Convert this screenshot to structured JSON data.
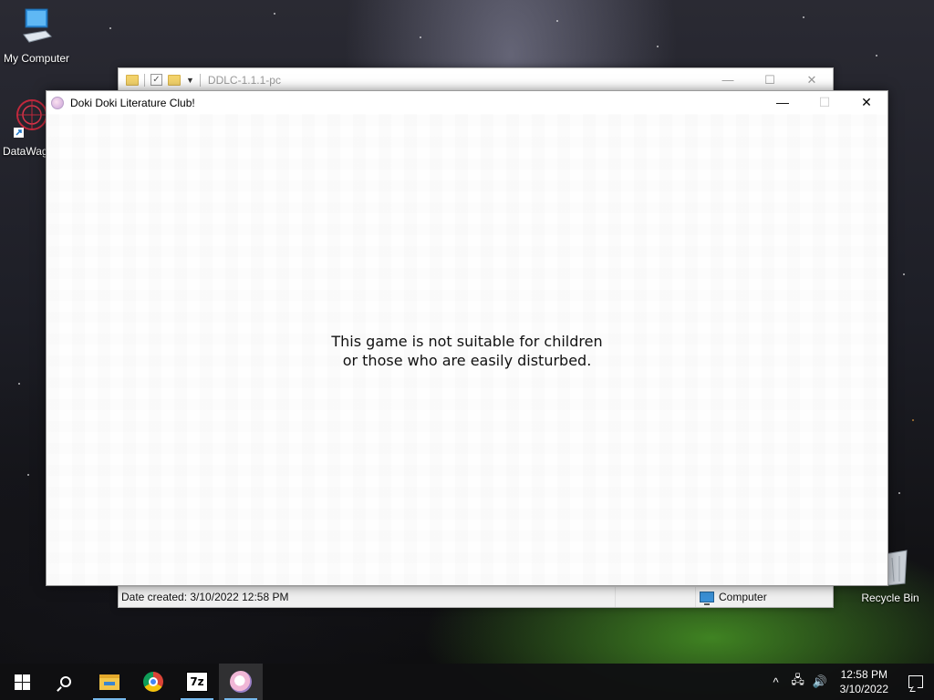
{
  "desktop": {
    "icons": [
      {
        "label": "My Computer",
        "icon": "monitor-icon"
      },
      {
        "label": "DataWag",
        "icon": "datawag-icon"
      },
      {
        "label": "Recycle Bin",
        "icon": "recycle-bin-icon"
      }
    ]
  },
  "explorer_window": {
    "title": "DDLC-1.1.1-pc",
    "status": {
      "date_created": "Date created: 3/10/2022 12:58 PM",
      "location": "Computer"
    }
  },
  "game_window": {
    "title": "Doki Doki Literature Club!",
    "warning_line1": "This game is not suitable for children",
    "warning_line2": "or those who are easily disturbed."
  },
  "taskbar": {
    "apps": [
      "start",
      "search",
      "file-explorer",
      "chrome",
      "7zip",
      "ddlc"
    ],
    "sevenzip_label": "7z",
    "clock_time": "12:58 PM",
    "clock_date": "3/10/2022"
  },
  "colors": {
    "taskbar_bg": "#101012",
    "taskbar_accent": "#76b9ed",
    "window_bg": "#ffffff"
  }
}
